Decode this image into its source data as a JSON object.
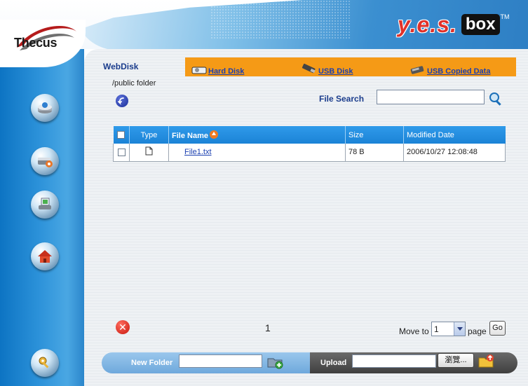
{
  "header": {
    "brand": "Thecus",
    "product_name": "y.e.s.",
    "product_box": "box",
    "trademark": "TM"
  },
  "sidebar": {
    "items": [
      {
        "icon": "disk-drive-icon"
      },
      {
        "icon": "network-settings-icon"
      },
      {
        "icon": "storage-monitor-icon"
      },
      {
        "icon": "home-icon"
      },
      {
        "icon": "key-icon"
      }
    ]
  },
  "main": {
    "title": "WebDisk",
    "tabs": [
      {
        "label": "Hard Disk",
        "icon": "hard-disk-icon"
      },
      {
        "label": "USB Disk",
        "icon": "usb-disk-icon"
      },
      {
        "label": "USB Copied Data",
        "icon": "usb-copied-data-icon"
      }
    ],
    "path": "/public folder",
    "search": {
      "label": "File Search",
      "value": "",
      "placeholder": ""
    },
    "table": {
      "columns": [
        "Type",
        "File Name",
        "Size",
        "Modified Date"
      ],
      "rows": [
        {
          "type_icon": "file-icon",
          "name": "File1.txt",
          "size": "78 B",
          "modified": "2006/10/27 12:08:48"
        }
      ]
    },
    "pagination": {
      "current_page": "1",
      "move_to_label": "Move to",
      "selected_page": "1",
      "page_label": "page",
      "go_label": "Go"
    }
  },
  "bottom_bar": {
    "new_folder_label": "New Folder",
    "upload_label": "Upload",
    "browse_label": "瀏覽..."
  },
  "colors": {
    "sidebar_blue": "#1b83d6",
    "tab_orange": "#f59a16",
    "table_header": "#2f9aea",
    "link_blue": "#1a3fb0",
    "brand_red": "#e0312a"
  }
}
